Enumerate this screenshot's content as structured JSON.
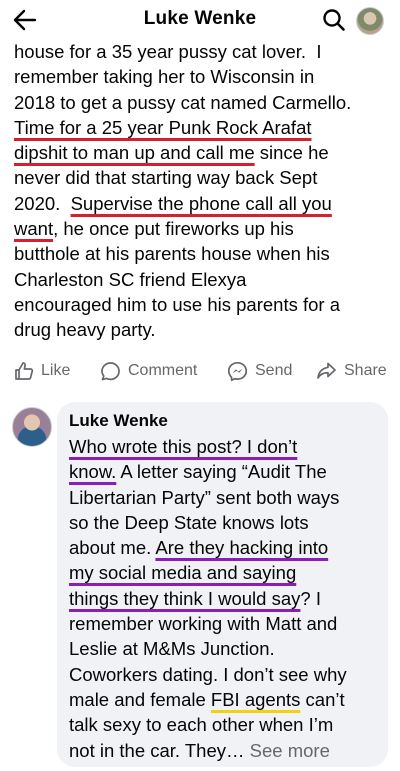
{
  "header": {
    "title": "Luke Wenke",
    "back_icon": "arrow-left-icon",
    "search_icon": "search-icon"
  },
  "post": {
    "lines": [
      [
        {
          "text": "house for a 35 year pussy cat lover.  I",
          "u": ""
        }
      ],
      [
        {
          "text": "remember taking her to Wisconsin in",
          "u": ""
        }
      ],
      [
        {
          "text": "2018 to get a pussy cat named Carmello.",
          "u": ""
        }
      ],
      [
        {
          "text": "Time for a 25 year Punk Rock Arafat",
          "u": "red"
        }
      ],
      [
        {
          "text": "dipshit to man up and call me",
          "u": "red"
        },
        {
          "text": " since he",
          "u": ""
        }
      ],
      [
        {
          "text": "never did that starting way back Sept",
          "u": ""
        }
      ],
      [
        {
          "text": "2020.  ",
          "u": ""
        },
        {
          "text": "Supervise the phone call all you",
          "u": "red"
        }
      ],
      [
        {
          "text": "want",
          "u": "red"
        },
        {
          "text": ", he once put fireworks up his",
          "u": ""
        }
      ],
      [
        {
          "text": "butthole at his parents house when his",
          "u": ""
        }
      ],
      [
        {
          "text": "Charleston SC friend Elexya",
          "u": ""
        }
      ],
      [
        {
          "text": "encouraged him to use his parents for a",
          "u": ""
        }
      ],
      [
        {
          "text": "drug heavy party.",
          "u": ""
        }
      ]
    ]
  },
  "actions": {
    "like": "Like",
    "comment": "Comment",
    "send": "Send",
    "share": "Share"
  },
  "comment": {
    "author": "Luke Wenke",
    "see_more": "See more",
    "lines": [
      [
        {
          "text": "Who wrote this post?  I don’t",
          "u": "purple"
        }
      ],
      [
        {
          "text": "know.",
          "u": "purple"
        },
        {
          "text": "  A letter saying “Audit The",
          "u": ""
        }
      ],
      [
        {
          "text": "Libertarian Party” sent both ways",
          "u": ""
        }
      ],
      [
        {
          "text": "so the Deep State knows lots",
          "u": ""
        }
      ],
      [
        {
          "text": "about me.  ",
          "u": ""
        },
        {
          "text": "Are they hacking into",
          "u": "purple"
        }
      ],
      [
        {
          "text": "my social media and saying",
          "u": "purple"
        }
      ],
      [
        {
          "text": "things they think I would say",
          "u": "purple"
        },
        {
          "text": "?  I",
          "u": ""
        }
      ],
      [
        {
          "text": "remember working with Matt and",
          "u": ""
        }
      ],
      [
        {
          "text": "Leslie at M&Ms Junction.",
          "u": ""
        }
      ],
      [
        {
          "text": "Coworkers dating.  I don’t see why",
          "u": ""
        }
      ],
      [
        {
          "text": "male and female ",
          "u": ""
        },
        {
          "text": "FBI agents",
          "u": "yellow"
        },
        {
          "text": " can’t",
          "u": ""
        }
      ],
      [
        {
          "text": "talk sexy to each other when I’m",
          "u": ""
        }
      ],
      [
        {
          "text": "not in the car.  They… ",
          "u": ""
        }
      ]
    ]
  },
  "colors": {
    "underline_red": "#d6202b",
    "underline_purple": "#8b1fb4",
    "underline_yellow": "#f2d20f",
    "muted_text": "#65676b",
    "bubble_bg": "#f0f2f5"
  }
}
